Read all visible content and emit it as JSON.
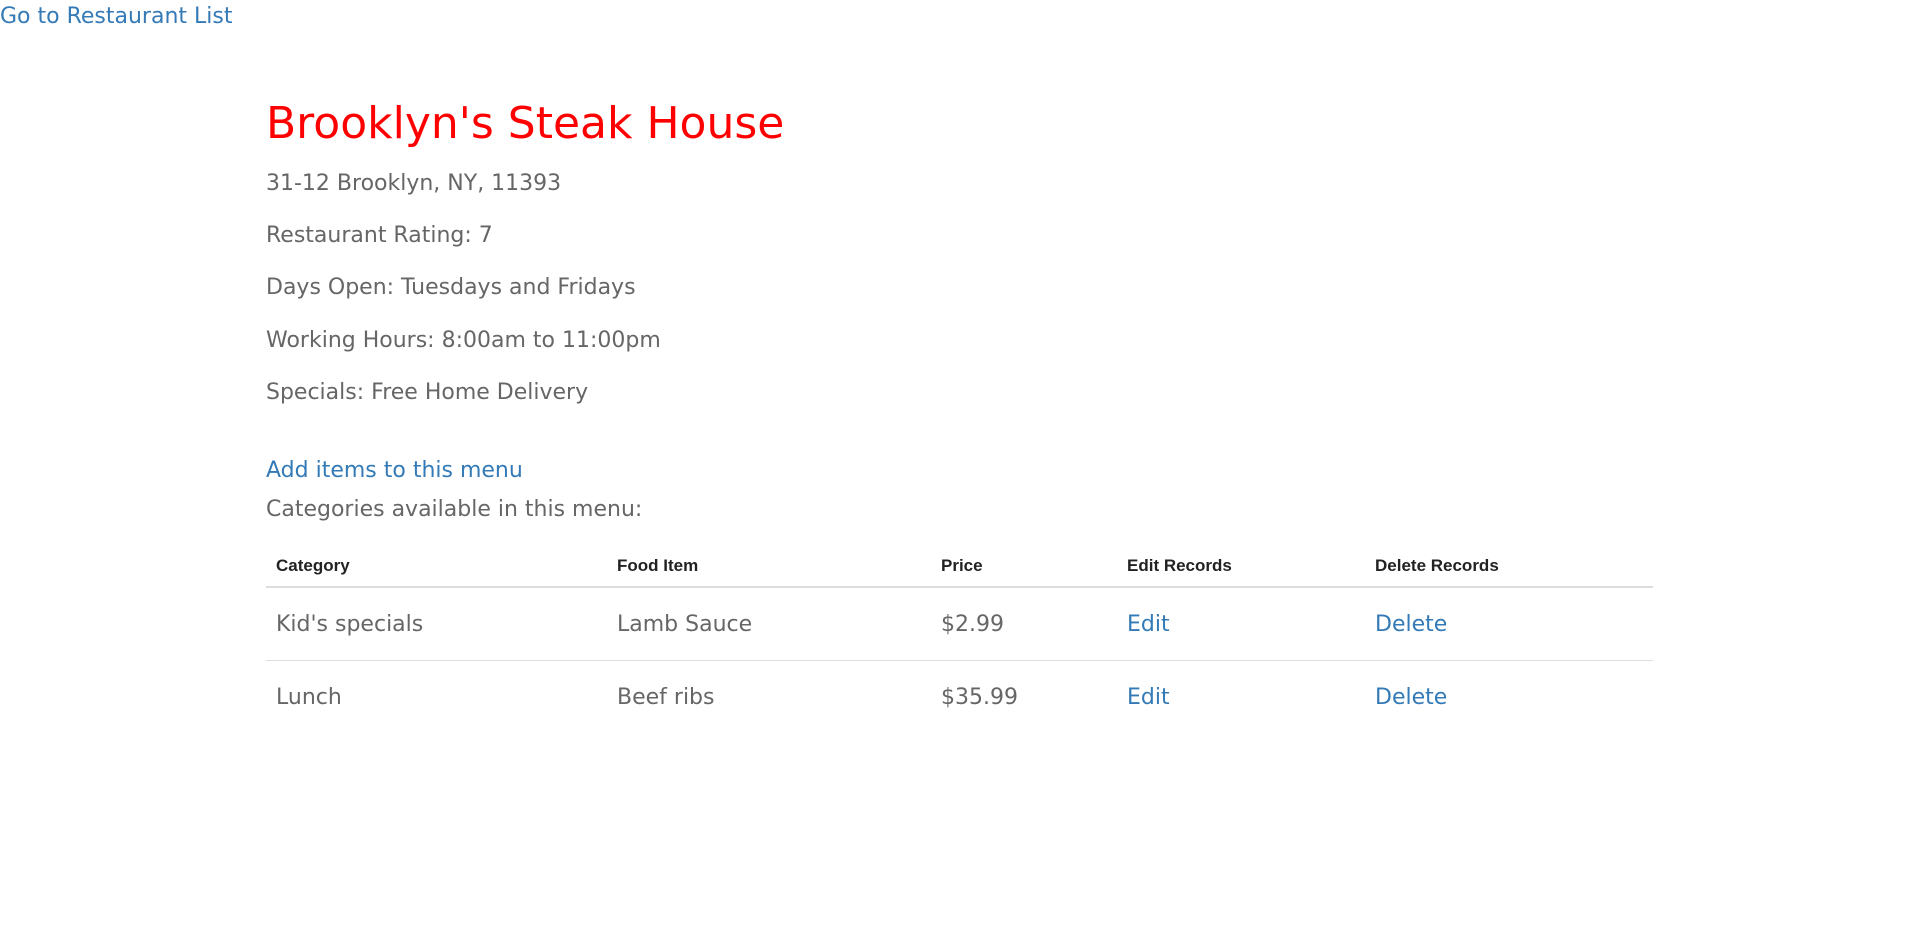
{
  "nav": {
    "back_link": "Go to Restaurant List"
  },
  "restaurant": {
    "name": "Brooklyn's Steak House",
    "address": "31-12 Brooklyn, NY, 11393",
    "rating": "Restaurant Rating: 7",
    "days_open": "Days Open: Tuesdays and Fridays",
    "hours": "Working Hours: 8:00am to 11:00pm",
    "specials": "Specials: Free Home Delivery"
  },
  "menu": {
    "add_link": "Add items to this menu",
    "categories_label": "Categories available in this menu:",
    "headers": [
      "Category",
      "Food Item",
      "Price",
      "Edit Records",
      "Delete Records"
    ],
    "rows": [
      {
        "category": "Kid's specials",
        "item": "Lamb Sauce",
        "price": "$2.99",
        "edit": "Edit",
        "delete": "Delete"
      },
      {
        "category": "Lunch",
        "item": "Beef ribs",
        "price": "$35.99",
        "edit": "Edit",
        "delete": "Delete"
      }
    ]
  },
  "colors": {
    "title": "#ff0000",
    "link": "#337ab7",
    "text": "#666666"
  }
}
